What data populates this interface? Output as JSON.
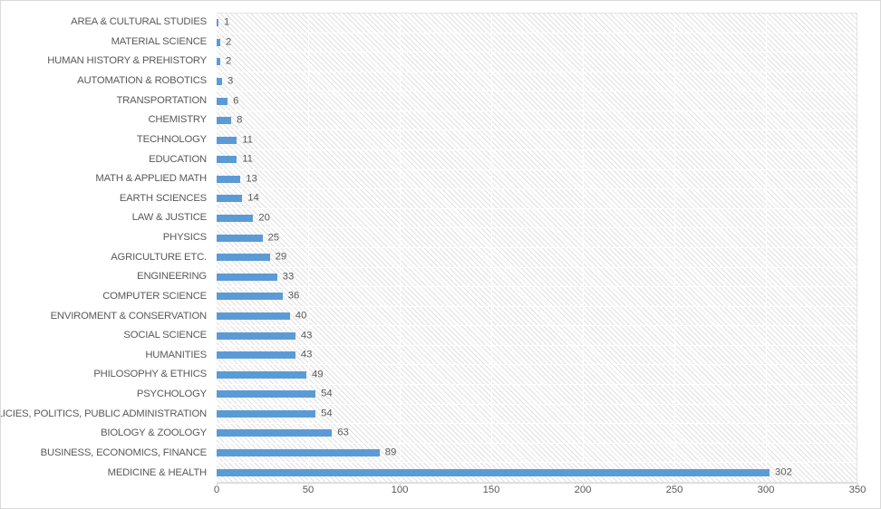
{
  "chart_data": {
    "type": "bar",
    "orientation": "horizontal",
    "title": "",
    "subtitle": "",
    "xlabel": "",
    "ylabel": "",
    "xlim": [
      0,
      350
    ],
    "xticks": [
      0,
      50,
      100,
      150,
      200,
      250,
      300,
      350
    ],
    "grid": "vertical-white-gridlines-on-hatched-plot-area",
    "legend": "none",
    "data_labels": true,
    "bar_color": "#5b9bd5",
    "plot_background": "#ffffff",
    "plot_hatch_color": "#e0e0e0",
    "text_color": "#595959",
    "categories": [
      "AREA & CULTURAL STUDIES",
      "MATERIAL SCIENCE",
      "HUMAN HISTORY & PREHISTORY",
      "AUTOMATION & ROBOTICS",
      "TRANSPORTATION",
      "CHEMISTRY",
      "TECHNOLOGY",
      "EDUCATION",
      "MATH & APPLIED MATH",
      "EARTH SCIENCES",
      "LAW & JUSTICE",
      "PHYSICS",
      "AGRICULTURE ETC.",
      "ENGINEERING",
      "COMPUTER SCIENCE",
      "ENVIROMENT & CONSERVATION",
      "SOCIAL SCIENCE",
      "HUMANITIES",
      "PHILOSOPHY & ETHICS",
      "PSYCHOLOGY",
      "POLICIES, POLITICS, PUBLIC ADMINISTRATION",
      "BIOLOGY & ZOOLOGY",
      "BUSINESS, ECONOMICS, FINANCE",
      "MEDICINE & HEALTH"
    ],
    "values": [
      1,
      2,
      2,
      3,
      6,
      8,
      11,
      11,
      13,
      14,
      20,
      25,
      29,
      33,
      36,
      40,
      43,
      43,
      49,
      54,
      54,
      63,
      89,
      302
    ]
  }
}
